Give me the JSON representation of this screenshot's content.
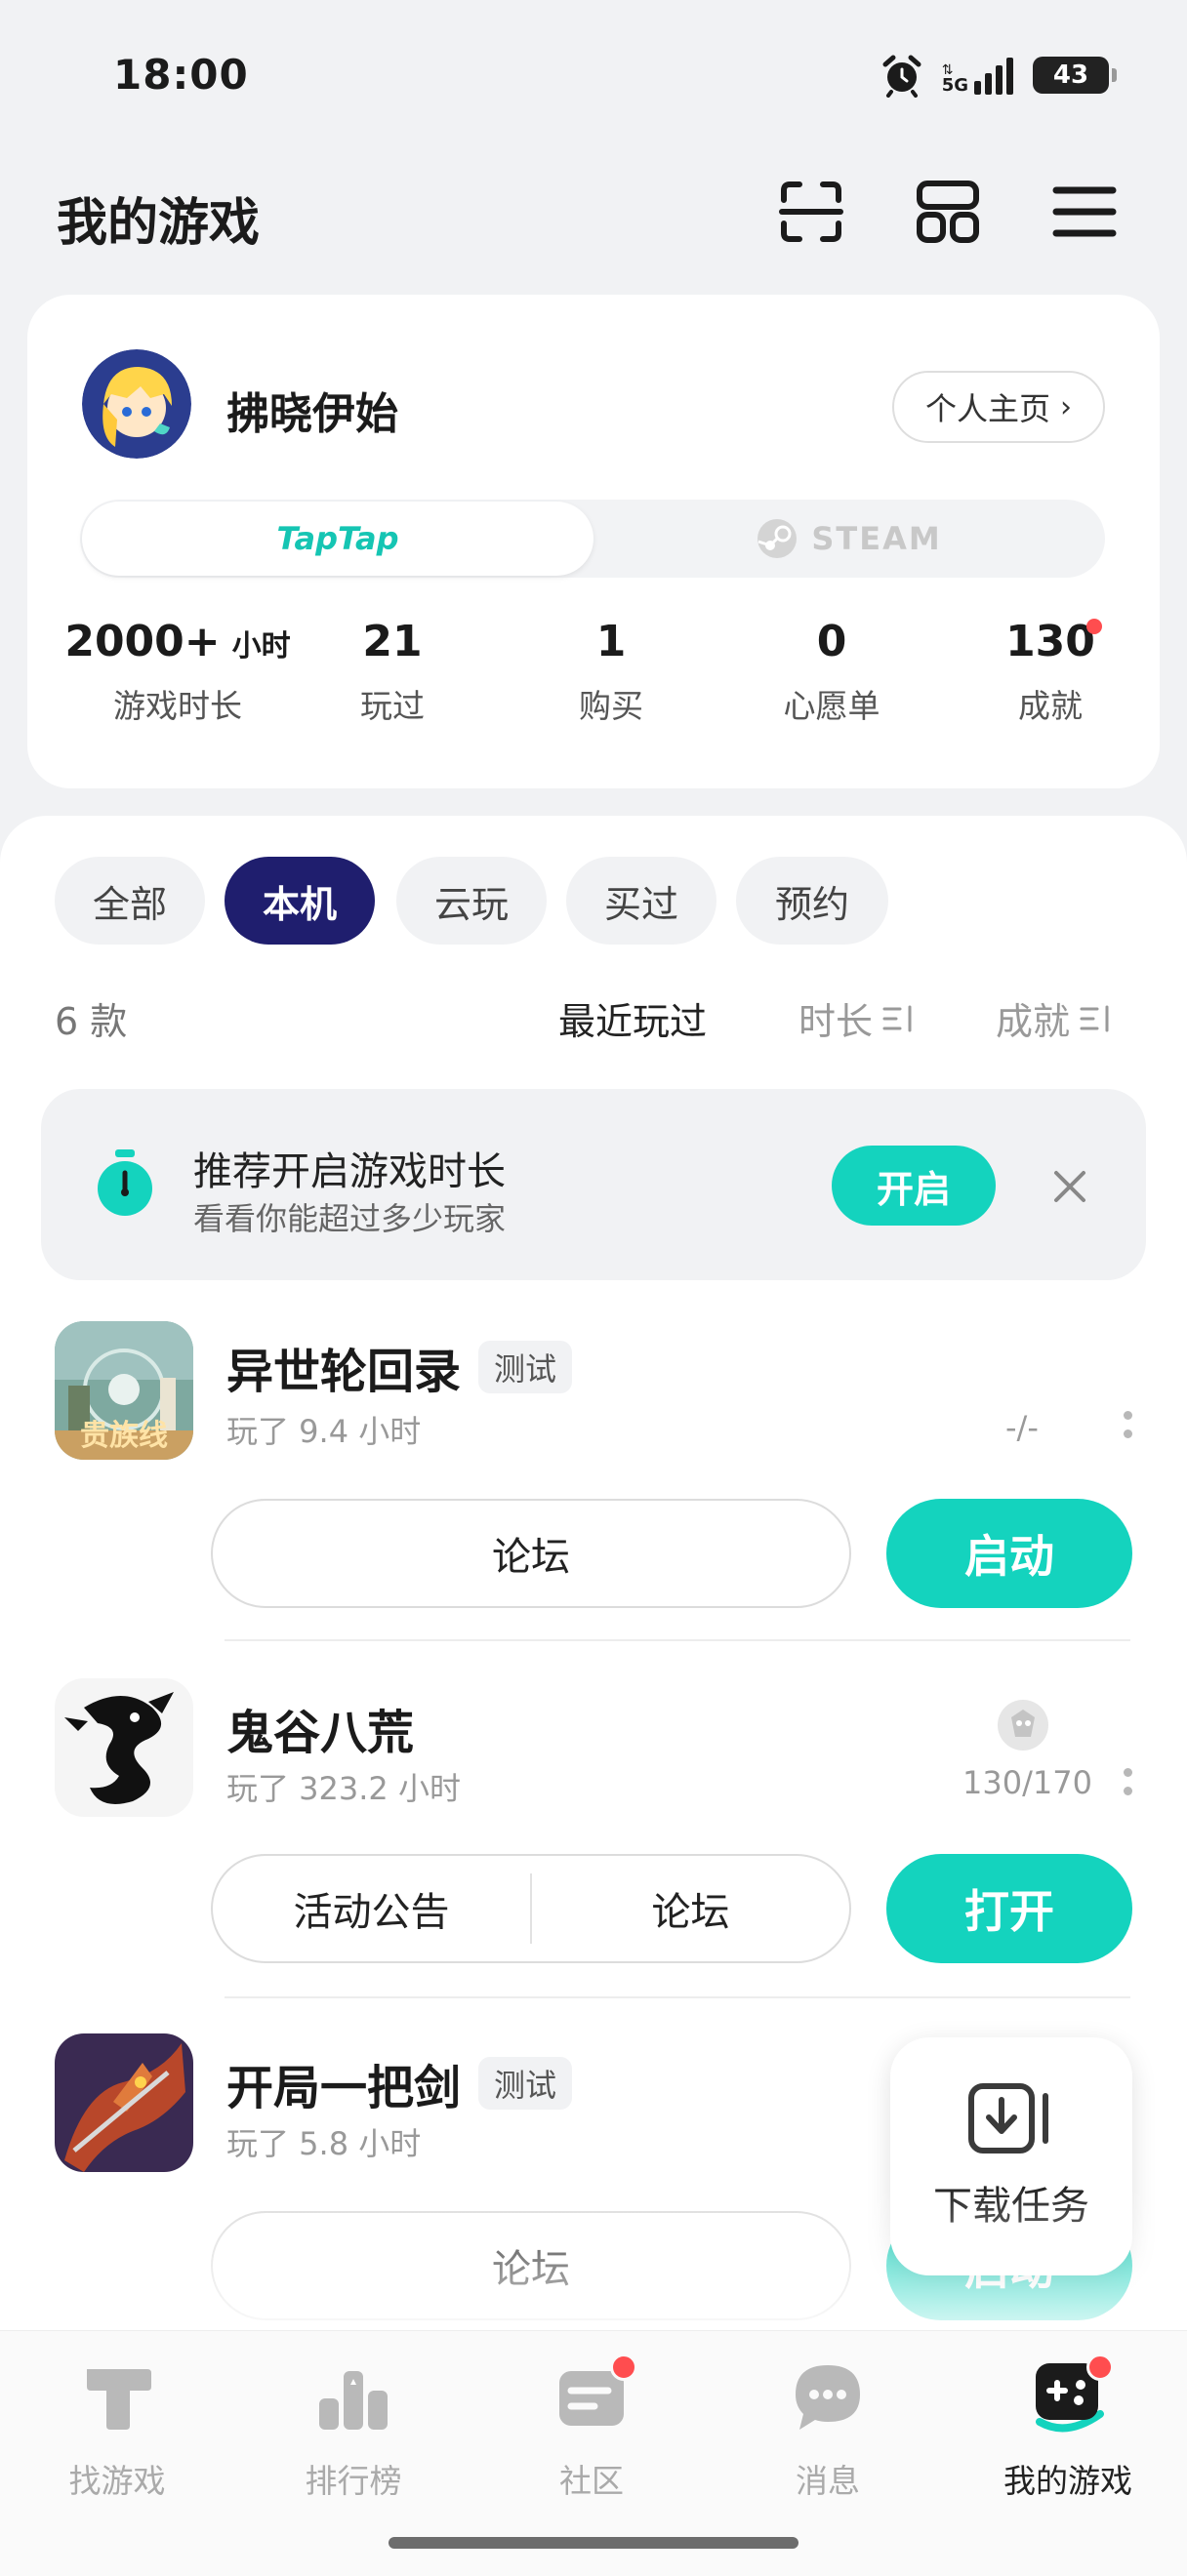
{
  "status_bar": {
    "time": "18:00",
    "network": "5G",
    "battery": "43"
  },
  "header": {
    "title": "我的游戏"
  },
  "profile": {
    "name": "拂晓伊始",
    "home_button": "个人主页",
    "platforms": {
      "taptap": "TapTap",
      "steam": "STEAM"
    },
    "stats": [
      {
        "value": "2000+",
        "unit": "小时",
        "label": "游戏时长"
      },
      {
        "value": "21",
        "label": "玩过"
      },
      {
        "value": "1",
        "label": "购买"
      },
      {
        "value": "0",
        "label": "心愿单"
      },
      {
        "value": "130",
        "label": "成就"
      }
    ]
  },
  "filters": [
    "全部",
    "本机",
    "云玩",
    "买过",
    "预约"
  ],
  "active_filter": "本机",
  "list_meta": {
    "count": "6 款",
    "sorts": [
      "最近玩过",
      "时长",
      "成就"
    ]
  },
  "banner": {
    "title": "推荐开启游戏时长",
    "subtitle": "看看你能超过多少玩家",
    "button": "开启"
  },
  "games": [
    {
      "name": "异世轮回录",
      "tag": "测试",
      "played": "玩了 9.4 小时",
      "achievement": "-/-",
      "buttons": [
        "论坛"
      ],
      "action": "启动",
      "icon_caption": "贵族线"
    },
    {
      "name": "鬼谷八荒",
      "played": "玩了 323.2 小时",
      "achievement": "130/170",
      "buttons": [
        "活动公告",
        "论坛"
      ],
      "action": "打开"
    },
    {
      "name": "开局一把剑",
      "tag": "测试",
      "played": "玩了 5.8 小时",
      "buttons": [
        "论坛"
      ],
      "action": "启动"
    }
  ],
  "download_popover": {
    "label": "下载任务"
  },
  "bottom_nav": [
    {
      "label": "找游戏"
    },
    {
      "label": "排行榜"
    },
    {
      "label": "社区"
    },
    {
      "label": "消息"
    },
    {
      "label": "我的游戏"
    }
  ],
  "colors": {
    "accent": "#14d3be",
    "active_chip": "#1f1e6e",
    "badge": "#ff4d4f"
  }
}
